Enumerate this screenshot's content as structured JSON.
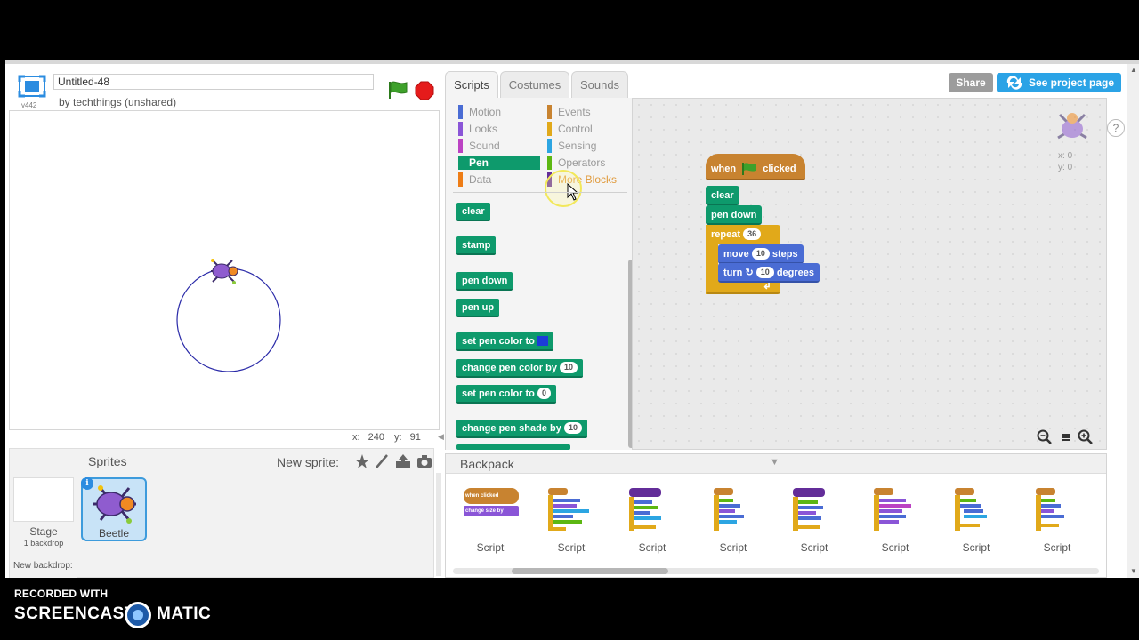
{
  "stage_header": {
    "version": "v442",
    "project_title": "Untitled-48",
    "byline": "by techthings (unshared)"
  },
  "stage": {
    "mouse_x_label": "x:",
    "mouse_x": "240",
    "mouse_y_label": "y:",
    "mouse_y": "91"
  },
  "sprites_pane": {
    "title": "Sprites",
    "new_sprite_label": "New sprite:",
    "stage_label": "Stage",
    "stage_sub": "1 backdrop",
    "new_backdrop_label": "New backdrop:",
    "sprite_name": "Beetle",
    "info_glyph": "i"
  },
  "tabs": [
    "Scripts",
    "Costumes",
    "Sounds"
  ],
  "header_buttons": {
    "share": "Share",
    "see_project": "See project page"
  },
  "categories": {
    "left": [
      {
        "label": "Motion",
        "color": "#4a6cd4"
      },
      {
        "label": "Looks",
        "color": "#8a55d7"
      },
      {
        "label": "Sound",
        "color": "#bb42c3"
      },
      {
        "label": "Pen",
        "color": "#0e9a6c"
      },
      {
        "label": "Data",
        "color": "#ee7d16"
      }
    ],
    "right": [
      {
        "label": "Events",
        "color": "#c88330"
      },
      {
        "label": "Control",
        "color": "#e1a91a"
      },
      {
        "label": "Sensing",
        "color": "#2ca5e2"
      },
      {
        "label": "Operators",
        "color": "#5cb712"
      },
      {
        "label": "More Blocks",
        "color": "#632d99"
      }
    ],
    "active": "Pen"
  },
  "palette_blocks": {
    "clear": "clear",
    "stamp": "stamp",
    "pen_down": "pen down",
    "pen_up": "pen up",
    "set_pen_color_to": "set pen color to",
    "change_pen_color_by": "change pen color by",
    "change_pen_color_value": "10",
    "set_pen_color_to_num": "set pen color to",
    "set_pen_color_num_value": "0",
    "change_pen_shade_by": "change pen shade by",
    "change_pen_shade_value": "10"
  },
  "script": {
    "when": "when",
    "clicked": "clicked",
    "clear": "clear",
    "pen_down": "pen down",
    "repeat": "repeat",
    "repeat_count": "36",
    "move": "move",
    "move_steps": "10",
    "steps": "steps",
    "turn": "turn",
    "turn_degrees": "10",
    "degrees": "degrees",
    "turn_arrow": "↻",
    "loop_arrow": "↲"
  },
  "sprite_position": {
    "x_label": "x:",
    "x": "0",
    "y_label": "y:",
    "y": "0"
  },
  "help_label": "?",
  "backpack": {
    "title": "Backpack",
    "arrow": "▼",
    "items": [
      {
        "label": "Script"
      },
      {
        "label": "Script"
      },
      {
        "label": "Script"
      },
      {
        "label": "Script"
      },
      {
        "label": "Script"
      },
      {
        "label": "Script"
      },
      {
        "label": "Script"
      },
      {
        "label": "Script"
      }
    ],
    "mini_hat_when": "when",
    "mini_hat_clicked": "clicked",
    "mini_block": "change size by"
  },
  "recorder": {
    "line1": "RECORDED WITH",
    "brand_left": "SCREENCAST",
    "brand_right": "MATIC"
  },
  "scroll_arrows": {
    "up": "▲",
    "down": "▼",
    "left": "◀"
  }
}
